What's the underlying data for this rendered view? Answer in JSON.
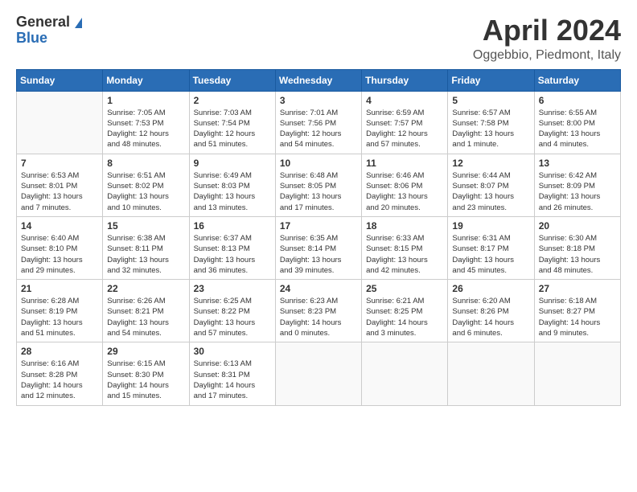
{
  "header": {
    "logo_line1": "General",
    "logo_line2": "Blue",
    "title": "April 2024",
    "location": "Oggebbio, Piedmont, Italy"
  },
  "weekdays": [
    "Sunday",
    "Monday",
    "Tuesday",
    "Wednesday",
    "Thursday",
    "Friday",
    "Saturday"
  ],
  "weeks": [
    [
      {
        "day": "",
        "info": ""
      },
      {
        "day": "1",
        "info": "Sunrise: 7:05 AM\nSunset: 7:53 PM\nDaylight: 12 hours\nand 48 minutes."
      },
      {
        "day": "2",
        "info": "Sunrise: 7:03 AM\nSunset: 7:54 PM\nDaylight: 12 hours\nand 51 minutes."
      },
      {
        "day": "3",
        "info": "Sunrise: 7:01 AM\nSunset: 7:56 PM\nDaylight: 12 hours\nand 54 minutes."
      },
      {
        "day": "4",
        "info": "Sunrise: 6:59 AM\nSunset: 7:57 PM\nDaylight: 12 hours\nand 57 minutes."
      },
      {
        "day": "5",
        "info": "Sunrise: 6:57 AM\nSunset: 7:58 PM\nDaylight: 13 hours\nand 1 minute."
      },
      {
        "day": "6",
        "info": "Sunrise: 6:55 AM\nSunset: 8:00 PM\nDaylight: 13 hours\nand 4 minutes."
      }
    ],
    [
      {
        "day": "7",
        "info": "Sunrise: 6:53 AM\nSunset: 8:01 PM\nDaylight: 13 hours\nand 7 minutes."
      },
      {
        "day": "8",
        "info": "Sunrise: 6:51 AM\nSunset: 8:02 PM\nDaylight: 13 hours\nand 10 minutes."
      },
      {
        "day": "9",
        "info": "Sunrise: 6:49 AM\nSunset: 8:03 PM\nDaylight: 13 hours\nand 13 minutes."
      },
      {
        "day": "10",
        "info": "Sunrise: 6:48 AM\nSunset: 8:05 PM\nDaylight: 13 hours\nand 17 minutes."
      },
      {
        "day": "11",
        "info": "Sunrise: 6:46 AM\nSunset: 8:06 PM\nDaylight: 13 hours\nand 20 minutes."
      },
      {
        "day": "12",
        "info": "Sunrise: 6:44 AM\nSunset: 8:07 PM\nDaylight: 13 hours\nand 23 minutes."
      },
      {
        "day": "13",
        "info": "Sunrise: 6:42 AM\nSunset: 8:09 PM\nDaylight: 13 hours\nand 26 minutes."
      }
    ],
    [
      {
        "day": "14",
        "info": "Sunrise: 6:40 AM\nSunset: 8:10 PM\nDaylight: 13 hours\nand 29 minutes."
      },
      {
        "day": "15",
        "info": "Sunrise: 6:38 AM\nSunset: 8:11 PM\nDaylight: 13 hours\nand 32 minutes."
      },
      {
        "day": "16",
        "info": "Sunrise: 6:37 AM\nSunset: 8:13 PM\nDaylight: 13 hours\nand 36 minutes."
      },
      {
        "day": "17",
        "info": "Sunrise: 6:35 AM\nSunset: 8:14 PM\nDaylight: 13 hours\nand 39 minutes."
      },
      {
        "day": "18",
        "info": "Sunrise: 6:33 AM\nSunset: 8:15 PM\nDaylight: 13 hours\nand 42 minutes."
      },
      {
        "day": "19",
        "info": "Sunrise: 6:31 AM\nSunset: 8:17 PM\nDaylight: 13 hours\nand 45 minutes."
      },
      {
        "day": "20",
        "info": "Sunrise: 6:30 AM\nSunset: 8:18 PM\nDaylight: 13 hours\nand 48 minutes."
      }
    ],
    [
      {
        "day": "21",
        "info": "Sunrise: 6:28 AM\nSunset: 8:19 PM\nDaylight: 13 hours\nand 51 minutes."
      },
      {
        "day": "22",
        "info": "Sunrise: 6:26 AM\nSunset: 8:21 PM\nDaylight: 13 hours\nand 54 minutes."
      },
      {
        "day": "23",
        "info": "Sunrise: 6:25 AM\nSunset: 8:22 PM\nDaylight: 13 hours\nand 57 minutes."
      },
      {
        "day": "24",
        "info": "Sunrise: 6:23 AM\nSunset: 8:23 PM\nDaylight: 14 hours\nand 0 minutes."
      },
      {
        "day": "25",
        "info": "Sunrise: 6:21 AM\nSunset: 8:25 PM\nDaylight: 14 hours\nand 3 minutes."
      },
      {
        "day": "26",
        "info": "Sunrise: 6:20 AM\nSunset: 8:26 PM\nDaylight: 14 hours\nand 6 minutes."
      },
      {
        "day": "27",
        "info": "Sunrise: 6:18 AM\nSunset: 8:27 PM\nDaylight: 14 hours\nand 9 minutes."
      }
    ],
    [
      {
        "day": "28",
        "info": "Sunrise: 6:16 AM\nSunset: 8:28 PM\nDaylight: 14 hours\nand 12 minutes."
      },
      {
        "day": "29",
        "info": "Sunrise: 6:15 AM\nSunset: 8:30 PM\nDaylight: 14 hours\nand 15 minutes."
      },
      {
        "day": "30",
        "info": "Sunrise: 6:13 AM\nSunset: 8:31 PM\nDaylight: 14 hours\nand 17 minutes."
      },
      {
        "day": "",
        "info": ""
      },
      {
        "day": "",
        "info": ""
      },
      {
        "day": "",
        "info": ""
      },
      {
        "day": "",
        "info": ""
      }
    ]
  ]
}
